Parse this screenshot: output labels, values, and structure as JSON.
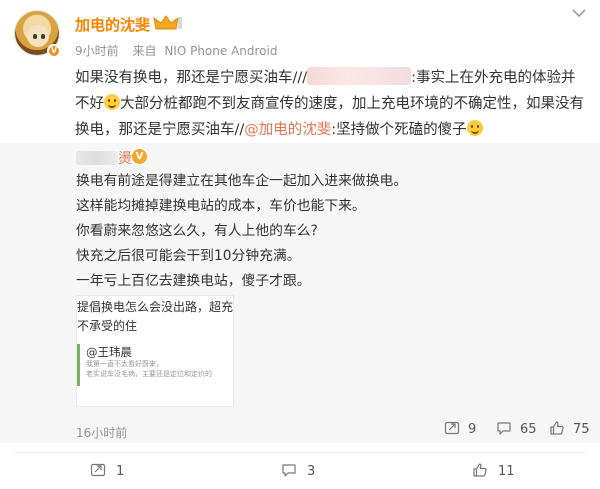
{
  "post": {
    "author": "加电的沈斐",
    "time": "9小时前",
    "source_prefix": "来自",
    "source": "NIO Phone Android",
    "text_part1": "如果没有换电，那还是宁愿买油车///",
    "text_part2": ":事实上在外充电的体验并不好",
    "text_part3": "大部分桩都跑不到友商宣传的速度，加上充电环境的不确定性，如果没有换电，那还是宁愿买油车//",
    "mention": "@加电的沈斐",
    "text_part4": ":坚持做个死磕的傻子"
  },
  "repost": {
    "user_suffix": "燙",
    "lines": [
      "换电有前途是得建立在其他车企一起加入进来做换电。",
      "这样能均摊掉建换电站的成本，车价也能下来。",
      "你看蔚来忽悠这么久，有人上他的车么?",
      "快充之后很可能会干到10分钟充满。",
      "一年亏上百亿去建换电站，傻子才跟。"
    ],
    "card": {
      "title_line1": "提倡换电怎么会没出路，超充多了",
      "title_line2": "不承受的住",
      "quote_name": "@王玮晨",
      "quote_line1": "我第一直不太看好蔚来，",
      "quote_line2": "老实说车没毛病，主要还是定位和定价的"
    },
    "time": "16小时前",
    "reposts": "9",
    "comments": "65",
    "likes": "75"
  },
  "actions": {
    "reposts": "1",
    "comments": "3",
    "likes": "11"
  },
  "colors": {
    "author": "#ff8200",
    "mention": "#eb7350",
    "repost_bg": "#f7f7f7"
  }
}
